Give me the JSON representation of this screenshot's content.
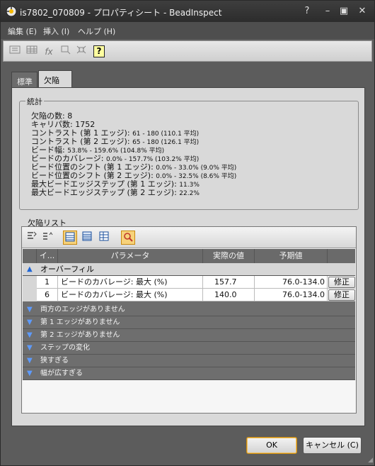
{
  "window": {
    "title": "is7802_070809 - プロパティシート - BeadInspect",
    "controls": [
      "?",
      "–",
      "▣",
      "✕"
    ]
  },
  "menu": [
    "編集 (E)",
    "挿入 (I)",
    "ヘルプ (H)"
  ],
  "toolbar": {
    "icons": [
      "insert-field-icon",
      "table-icon",
      "function-icon",
      "shape-icon",
      "fit-icon",
      "help-icon"
    ],
    "help_glyph": "?"
  },
  "tabs": [
    {
      "label": "標準",
      "active": false
    },
    {
      "label": "欠陥",
      "active": true
    }
  ],
  "stats": {
    "legend": "統計",
    "lines": [
      {
        "label": "欠陥の数:",
        "value": "8"
      },
      {
        "label": "キャリパ数:",
        "value": "1752"
      },
      {
        "label": "コントラスト (第 1 エッジ):",
        "value": "61 - 180 (110.1 平均)"
      },
      {
        "label": "コントラスト (第 2 エッジ):",
        "value": "65 - 180 (126.1 平均)"
      },
      {
        "label": "ビード幅:",
        "value": "53.8% - 159.6% (104.8% 平均)"
      },
      {
        "label": "ビードのカバレージ:",
        "value": "0.0% - 157.7% (103.2% 平均)"
      },
      {
        "label": "ビード位置のシフト (第 1 エッジ):",
        "value": "0.0% - 33.0% (9.0% 平均)"
      },
      {
        "label": "ビード位置のシフト (第 2 エッジ):",
        "value": "0.0% - 32.5% (8.6% 平均)"
      },
      {
        "label": "最大ビードエッジステップ (第 1 エッジ):",
        "value": "11.3%"
      },
      {
        "label": "最大ビードエッジステップ (第 2 エッジ):",
        "value": "22.2%"
      }
    ]
  },
  "defect_list": {
    "label": "欠陥リスト",
    "columns": [
      "イ...",
      "パラメータ",
      "実際の値",
      "予期値"
    ],
    "groups": [
      {
        "label": "オーバーフィル",
        "expanded": true,
        "rows": [
          {
            "index": "1",
            "parameter": "ビードのカバレージ: 最大 (%)",
            "actual": "157.7",
            "expected": "76.0-134.0",
            "action": "修正"
          },
          {
            "index": "6",
            "parameter": "ビードのカバレージ: 最大 (%)",
            "actual": "140.0",
            "expected": "76.0-134.0",
            "action": "修正"
          }
        ]
      },
      {
        "label": "両方のエッジがありません",
        "expanded": false
      },
      {
        "label": "第 1 エッジがありません",
        "expanded": false
      },
      {
        "label": "第 2 エッジがありません",
        "expanded": false
      },
      {
        "label": "ステップの変化",
        "expanded": false
      },
      {
        "label": "狭すぎる",
        "expanded": false
      },
      {
        "label": "幅が広すぎる",
        "expanded": false
      }
    ]
  },
  "buttons": {
    "ok": "OK",
    "cancel": "キャンセル (C)"
  },
  "colors": {
    "accent": "#f7d27a",
    "chevron": "#5d9bff"
  }
}
